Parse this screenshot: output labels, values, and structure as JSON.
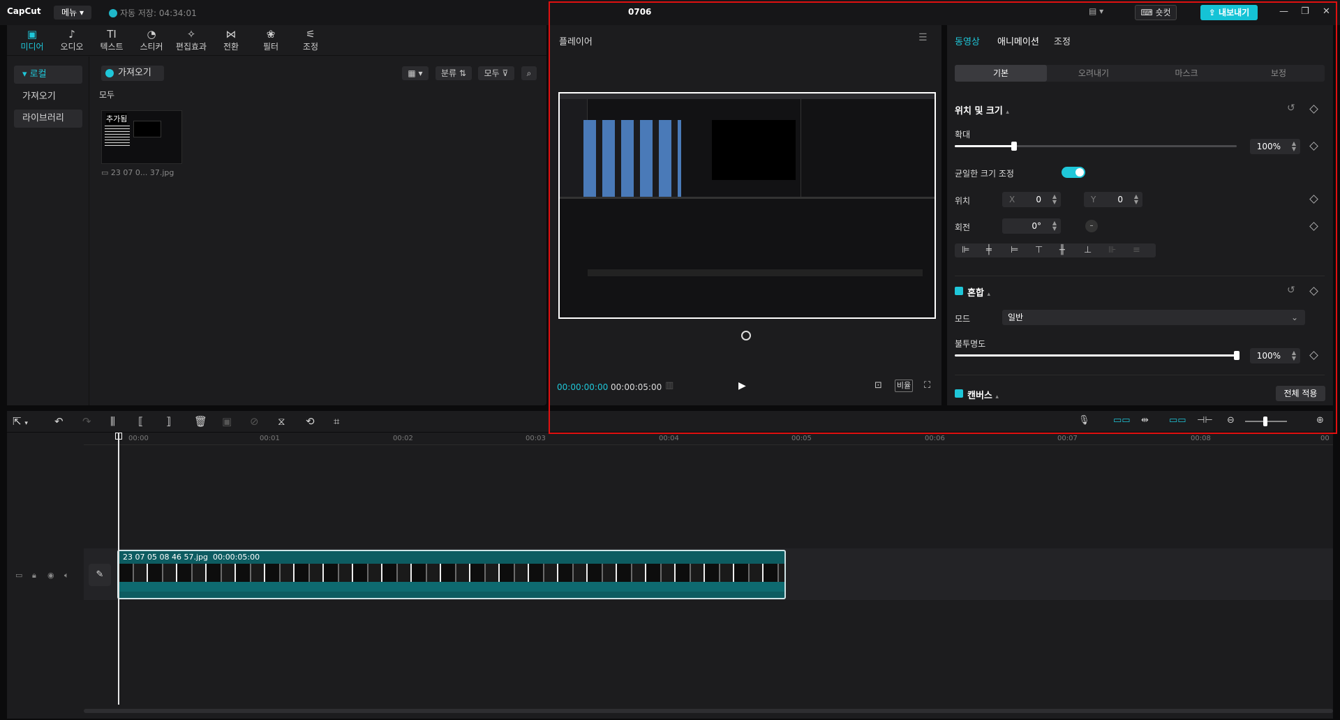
{
  "titlebar": {
    "logo": "CapCut",
    "menu": "메뉴",
    "autosave": "자동 저장: 04:34:01",
    "project_title": "0706",
    "shortcut": "숏컷",
    "export": "내보내기"
  },
  "media_tools": [
    {
      "label": "미디어",
      "icon": "▣"
    },
    {
      "label": "오디오",
      "icon": "♪"
    },
    {
      "label": "텍스트",
      "icon": "TI"
    },
    {
      "label": "스티커",
      "icon": "◔"
    },
    {
      "label": "편집효과",
      "icon": "✧"
    },
    {
      "label": "전환",
      "icon": "⋈"
    },
    {
      "label": "필터",
      "icon": "❀"
    },
    {
      "label": "조정",
      "icon": "⚟"
    }
  ],
  "sidenav": {
    "local": "로컬",
    "import": "가져오기",
    "library": "라이브러리"
  },
  "media": {
    "import_button": "가져오기",
    "sort_button": "분류",
    "filter_button": "모두",
    "all_label": "모두",
    "thumb_badge": "추가됨",
    "thumb_name": "23 07 0... 37.jpg"
  },
  "player": {
    "title": "플레이어",
    "timecode_current": "00:00:00:00",
    "timecode_duration": "00:00:05:00",
    "ratio": "비율"
  },
  "inspector": {
    "tabs": [
      "동영상",
      "애니메이션",
      "조정"
    ],
    "subtabs": [
      "기본",
      "오려내기",
      "마스크",
      "보정"
    ],
    "position_size": "위치 및 크기",
    "scale_label": "확대",
    "scale_value": "100%",
    "scale_fraction": 0.21,
    "uniform_scale": "균일한 크기 조정",
    "position_label": "위치",
    "pos_x_label": "X",
    "pos_x": "0",
    "pos_y_label": "Y",
    "pos_y": "0",
    "rotation_label": "회전",
    "rotation_value": "0°",
    "blend_title": "혼합",
    "mode_label": "모드",
    "mode_value": "일반",
    "opacity_label": "불투명도",
    "opacity_value": "100%",
    "opacity_fraction": 1.0,
    "canvas_title": "캔버스",
    "apply_all": "전체 적용"
  },
  "timeline": {
    "ticks": [
      "00:00",
      "00:01",
      "00:02",
      "00:03",
      "00:04",
      "00:05",
      "00:06",
      "00:07",
      "00:08",
      "00"
    ],
    "clip_name": "23 07 05 08 46 57.jpg",
    "clip_duration": "00:00:05:00"
  },
  "colors": {
    "accent": "#1fc7d9",
    "highlight": "#e01010",
    "clip": "#0d5c61"
  }
}
